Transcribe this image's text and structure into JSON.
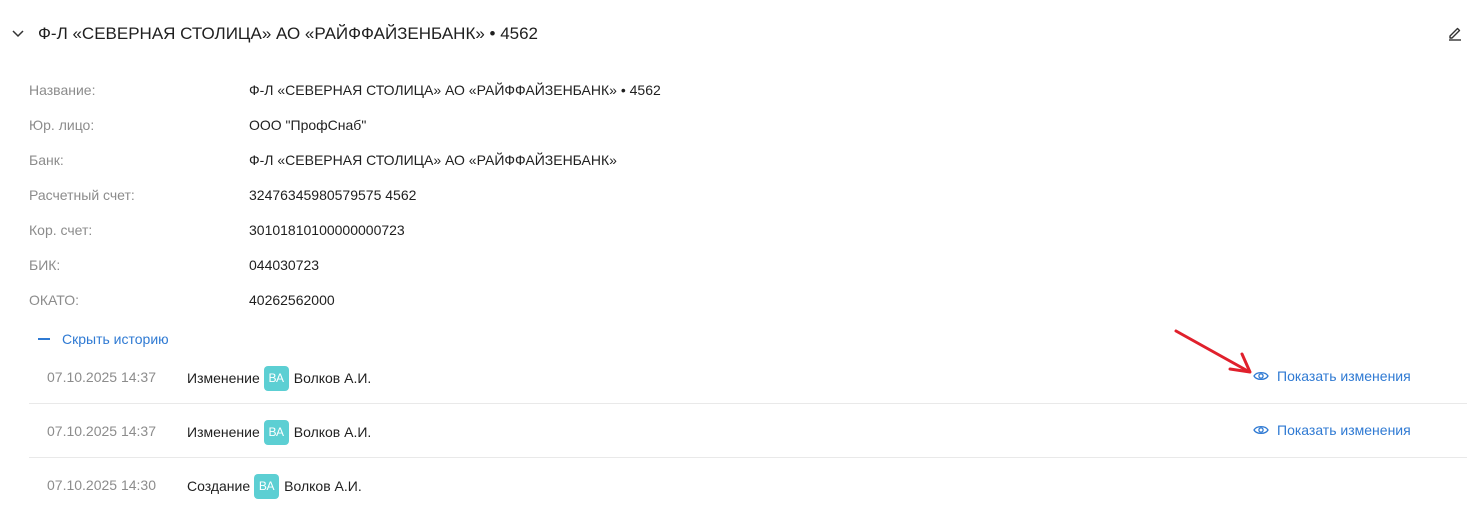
{
  "header": {
    "title": "Ф-Л «СЕВЕРНАЯ СТОЛИЦА» АО «РАЙФФАЙЗЕНБАНК» • 4562",
    "collapse_icon": "chevron-down-icon",
    "edit_icon": "pencil-icon"
  },
  "fields": [
    {
      "label": "Название:",
      "value": "Ф-Л «СЕВЕРНАЯ СТОЛИЦА» АО «РАЙФФАЙЗЕНБАНК» • 4562"
    },
    {
      "label": "Юр. лицо:",
      "value": "ООО \"ПрофСнаб\""
    },
    {
      "label": "Банк:",
      "value": "Ф-Л «СЕВЕРНАЯ СТОЛИЦА» АО «РАЙФФАЙЗЕНБАНК»"
    },
    {
      "label": "Расчетный счет:",
      "value": "32476345980579575 4562"
    },
    {
      "label": "Кор. счет:",
      "value": "30101810100000000723"
    },
    {
      "label": "БИК:",
      "value": "044030723"
    },
    {
      "label": "ОКАТО:",
      "value": "40262562000"
    }
  ],
  "history_toggle": {
    "label": "Скрыть историю"
  },
  "history": [
    {
      "date": "07.10.2025 14:37",
      "action": "Изменение",
      "avatar": "ВА",
      "author": "Волков А.И.",
      "show_changes": "Показать изменения"
    },
    {
      "date": "07.10.2025 14:37",
      "action": "Изменение",
      "avatar": "ВА",
      "author": "Волков А.И.",
      "show_changes": "Показать изменения"
    },
    {
      "date": "07.10.2025 14:30",
      "action": "Создание",
      "avatar": "ВА",
      "author": "Волков А.И."
    }
  ],
  "colors": {
    "accent": "#2f7ad3",
    "avatar_bg": "#5ccfd3",
    "label_gray": "#8c8c8c",
    "annotation_red": "#e0202c"
  }
}
